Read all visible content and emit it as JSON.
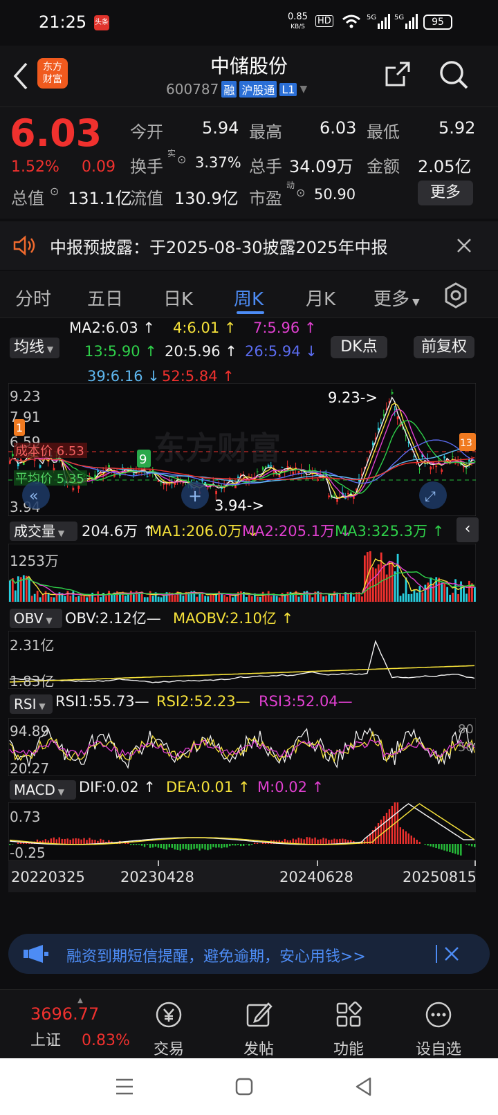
{
  "status_bar": {
    "time": "21:25",
    "app_badge": "头条",
    "net_speed": "0.85",
    "net_unit": "KB/S",
    "hd": "HD",
    "signal1": "5G",
    "signal2": "5G",
    "battery": "95"
  },
  "header": {
    "back_icon": "back-arrow-icon",
    "logo_text_1": "东方",
    "logo_text_2": "财富",
    "stock_name": "中储股份",
    "stock_code": "600787",
    "tag1": "融",
    "tag2": "沪股通",
    "tag3": "L1",
    "share_icon": "share-icon",
    "search_icon": "search-icon"
  },
  "quote": {
    "price": "6.03",
    "change_pct": "1.52%",
    "change": "0.09",
    "open_label": "今开",
    "open": "5.94",
    "high_label": "最高",
    "high": "6.03",
    "low_label": "最低",
    "low": "5.92",
    "turnover_label": "换手",
    "turnover_sup": "实",
    "turnover": "3.37%",
    "volume_label": "总手",
    "volume": "34.09万",
    "amount_label": "金额",
    "amount": "2.05亿",
    "mktcap_label": "总值",
    "mktcap": "131.1亿",
    "float_label": "流值",
    "float": "130.9亿",
    "pe_label": "市盈",
    "pe_sup": "动",
    "pe": "50.90",
    "more": "更多"
  },
  "notice": {
    "text": "中报预披露：于2025-08-30披露2025年中报"
  },
  "tabs": [
    {
      "label": "分时",
      "active": false
    },
    {
      "label": "五日",
      "active": false
    },
    {
      "label": "日K",
      "active": false
    },
    {
      "label": "周K",
      "active": true
    },
    {
      "label": "月K",
      "active": false
    },
    {
      "label": "更多",
      "active": false
    }
  ],
  "ma_bar": {
    "selector": "均线",
    "dk": "DK点",
    "fq": "前复权",
    "items": [
      {
        "text": "MA2:6.03 ↑",
        "color": "#f2f2f2"
      },
      {
        "text": "4:6.01 ↑",
        "color": "#f5e13a"
      },
      {
        "text": "7:5.96 ↑",
        "color": "#e040d0"
      },
      {
        "text": "13:5.90 ↑",
        "color": "#2fd04a"
      },
      {
        "text": "20:5.96 ↑",
        "color": "#f2f2f2"
      },
      {
        "text": "26:5.94 ↓",
        "color": "#5b6cf0"
      },
      {
        "text": "39:6.16 ↓",
        "color": "#5fb8f0"
      },
      {
        "text": "52:5.84 ↑",
        "color": "#f0312e"
      }
    ]
  },
  "kline": {
    "y_max": "9.23",
    "y_2": "7.91",
    "y_3": "6.59",
    "y_min": "3.94",
    "high_note": "9.23->",
    "low_note": "3.94->",
    "cost_label": "成本价 6.53",
    "cost_label2": "平均价 5.35",
    "watermark": "东方财富",
    "marker1": "1",
    "marker2": "9",
    "marker3": "13"
  },
  "volume": {
    "selector": "成交量",
    "vol": "204.6万 ↑",
    "ma1": "MA1:206.0万 ↓",
    "ma2": "MA2:205.1万 ↓",
    "ma3": "MA3:325.3万 ↑",
    "y_max": "1253万"
  },
  "obv": {
    "selector": "OBV",
    "obv": "OBV:2.12亿—",
    "maobv": "MAOBV:2.10亿 ↑",
    "y_max": "2.31亿",
    "y_min": "1.83亿"
  },
  "rsi": {
    "selector": "RSI",
    "rsi1": "RSI1:55.73—",
    "rsi2": "RSI2:52.23—",
    "rsi3": "RSI3:52.04—",
    "y_max": "94.89",
    "y_min": "20.27",
    "r80": "80",
    "r50": "50"
  },
  "macd": {
    "selector": "MACD",
    "dif": "DIF:0.02 ↑",
    "dea": "DEA:0.01 ↑",
    "m": "M:0.02 ↑",
    "y_max": "0.73",
    "y_min": "-0.25"
  },
  "dates": [
    "20220325",
    "20230428",
    "20240628",
    "20250815"
  ],
  "banner": {
    "text": "融资到期短信提醒，避免逾期，安心用钱>>"
  },
  "bottom_nav": {
    "index_value": "3696.77",
    "index_name": "上证",
    "index_change": "0.83%",
    "items": [
      {
        "label": "交易",
        "icon": "yen-icon"
      },
      {
        "label": "发帖",
        "icon": "edit-icon"
      },
      {
        "label": "功能",
        "icon": "grid-icon"
      },
      {
        "label": "设自选",
        "icon": "more-icon"
      }
    ]
  },
  "colors": {
    "up": "#f0312e",
    "down": "#27c23b",
    "accent": "#4d8cf5"
  }
}
